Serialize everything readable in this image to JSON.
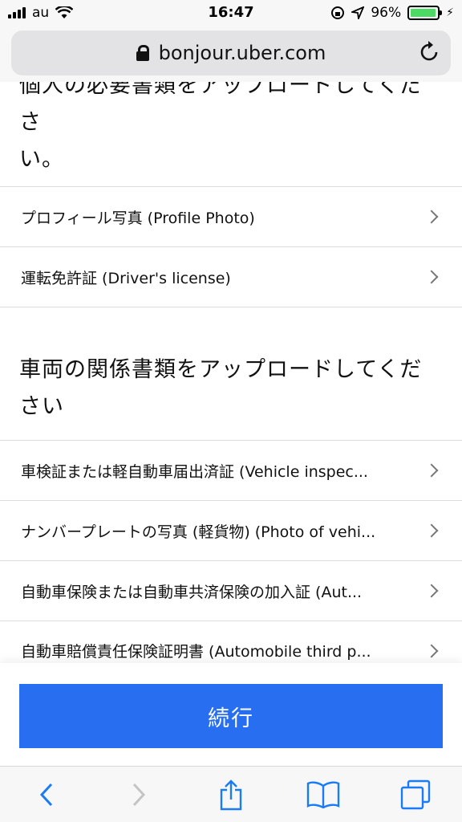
{
  "status_bar": {
    "carrier": "au",
    "time": "16:47",
    "battery_percent": "96%"
  },
  "url_bar": {
    "domain": "bonjour.uber.com"
  },
  "personal_docs": {
    "heading_cut": "個人の必要書類をアップロードしてくださ",
    "heading_tail": "い。",
    "items": [
      {
        "label": "プロフィール写真 (Profile Photo)"
      },
      {
        "label": "運転免許証 (Driver's license)"
      }
    ]
  },
  "vehicle_docs": {
    "heading": "車両の関係書類をアップロードしてください",
    "items": [
      {
        "label": "車検証または軽自動車届出済証 (Vehicle inspec..."
      },
      {
        "label": "ナンバープレートの写真 (軽貨物) (Photo of vehi..."
      },
      {
        "label": "自動車保険または自動車共済保険の加入証 (Aut..."
      },
      {
        "label": "自動車賠償責任保険証明書 (Automobile third p..."
      }
    ]
  },
  "cta": {
    "label": "続行",
    "color": "#276ef1"
  },
  "toolbar": {
    "icons": [
      "back-icon",
      "forward-icon",
      "share-icon",
      "bookmarks-icon",
      "tabs-icon"
    ],
    "accent": "#1a7cf5"
  }
}
